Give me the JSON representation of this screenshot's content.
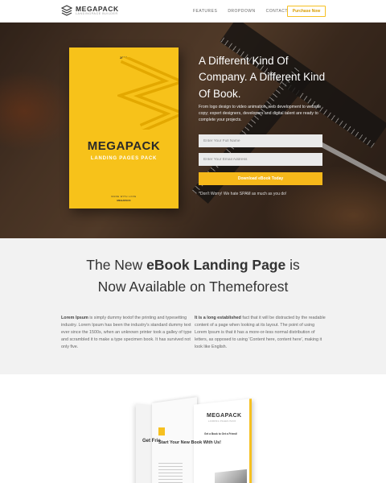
{
  "nav": {
    "logo_name": "MEGAPACK",
    "logo_tag": "LANDINGPAGE BUILDER",
    "menu": [
      "FEATURES",
      "DROPDOWN",
      "CONTACT"
    ],
    "purchase_label": "Purchase Now",
    "accent": "#f6c020"
  },
  "hero": {
    "book": {
      "year": "2016",
      "title": "MEGAPACK",
      "subtitle": "LANDING PAGES PACK",
      "made_with": "MADE WITH LOVE",
      "publisher": "MEGAPACK"
    },
    "heading": "A Different Kind Of Company. A Different Kind Of Book.",
    "paragraph": "From logo design to video animation, web development to website copy; expert designers, developers and digital talent are ready to complete your projects.",
    "name_placeholder": "Enter Your Full Name",
    "email_placeholder": "Enter Your Email Address",
    "download_label": "Download eBook Today",
    "spam_note": "*Don't Worry! We hate SPAM as much as you do!"
  },
  "intro": {
    "heading_pre": "The New ",
    "heading_bold": "eBook Landing Page",
    "heading_post": " is",
    "heading_line2": "Now Available on Themeforest",
    "col1_bold": "Lorem Ipsum",
    "col1_text": " is simply dummy textof the printing and typesetting industry. Lorem Ipsum has been the industry's standard dummy text ever since the 1500s, when an unknown printer took a galley of type and scrambled it to make a type specimen book. It has survived not only five.",
    "col2_bold": "It is a long established",
    "col2_text": " fact that it will be distracted by the readable content of a page when looking at its layout. The point of using Lorem Ipsum is that it has a more-or-less normal distribution of letters, as opposed to using 'Content here, content here', making it look like English."
  },
  "open_book": {
    "title": "MEGAPACK",
    "tag": "LANDING PAGES PACK",
    "get_line": "Get a Book to Get a Friend!",
    "left_heading": "Start Your New Book With Us!",
    "edge_text": "Get Frie"
  }
}
